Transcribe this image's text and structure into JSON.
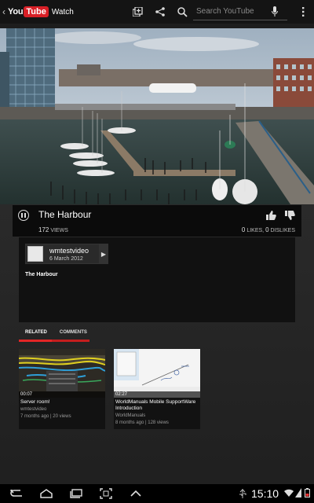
{
  "header": {
    "logo_you": "You",
    "logo_tube": "Tube",
    "title": "Watch",
    "search_placeholder": "Search YouTube"
  },
  "video": {
    "title": "The Harbour",
    "views_count": "172",
    "views_label": "VIEWS",
    "likes_count": "0",
    "likes_label": "LIKES,",
    "dislikes_count": "0",
    "dislikes_label": "DISLIKES"
  },
  "details": {
    "uploader": "wmtestvideo",
    "upload_date": "6 March 2012",
    "description_title": "The Harbour"
  },
  "tabs": [
    {
      "label": "RELATED",
      "active": true
    },
    {
      "label": "COMMENTS",
      "active": false
    }
  ],
  "related": [
    {
      "duration": "00:07",
      "title": "Server room!",
      "author": "wmtestvideo",
      "meta": "7 months ago | 20 views"
    },
    {
      "duration": "02:27",
      "title": "WorldManuals Mobile SupportWare Introduction",
      "author": "WorldManuals",
      "meta": "8 months ago | 128 views"
    }
  ],
  "status": {
    "time": "15:10"
  },
  "colors": {
    "accent_red": "#d81f26",
    "tab_red": "#e32626",
    "background": "#1b1b1b"
  },
  "icons": [
    "back-icon",
    "add-to-playlist-icon",
    "share-icon",
    "search-icon",
    "microphone-icon",
    "overflow-menu-icon",
    "pause-icon",
    "like-icon",
    "dislike-icon",
    "nav-back-icon",
    "nav-home-icon",
    "nav-recent-apps-icon",
    "screenshot-icon",
    "nav-up-icon",
    "usb-icon",
    "wifi-icon",
    "signal-icon",
    "battery-icon"
  ]
}
